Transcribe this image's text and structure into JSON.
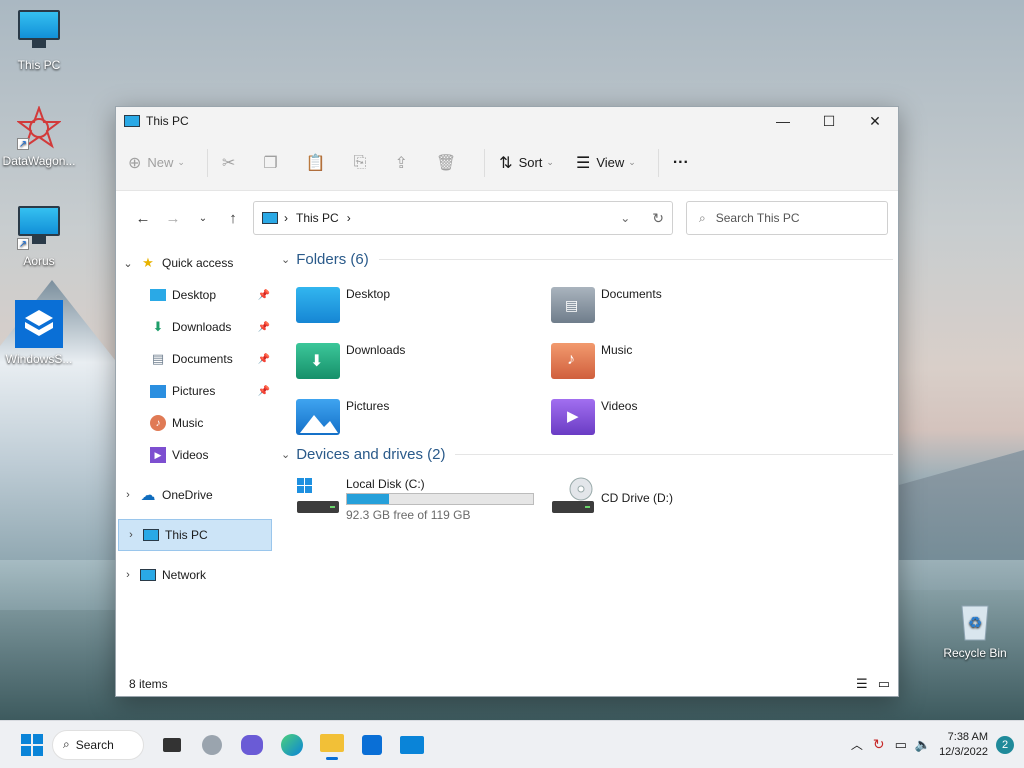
{
  "desktop": {
    "icons": [
      {
        "label": "This PC"
      },
      {
        "label": "DataWagon..."
      },
      {
        "label": "Aorus"
      },
      {
        "label": "WindowsS..."
      },
      {
        "label": "Recycle Bin"
      }
    ]
  },
  "window": {
    "title": "This PC",
    "controls": {
      "minimize": "—",
      "maximize": "☐",
      "close": "✕"
    },
    "commands": {
      "new_label": "New",
      "sort_label": "Sort",
      "view_label": "View",
      "more_label": "···"
    },
    "address": {
      "path": "This PC"
    },
    "search": {
      "placeholder": "Search This PC"
    },
    "sidebar": {
      "quick_access": "Quick access",
      "items": [
        {
          "label": "Desktop",
          "pinned": true
        },
        {
          "label": "Downloads",
          "pinned": true
        },
        {
          "label": "Documents",
          "pinned": true
        },
        {
          "label": "Pictures",
          "pinned": true
        },
        {
          "label": "Music",
          "pinned": false
        },
        {
          "label": "Videos",
          "pinned": false
        }
      ],
      "onedrive": "OneDrive",
      "this_pc": "This PC",
      "network": "Network"
    },
    "content": {
      "folders_header": "Folders (6)",
      "folders": [
        {
          "label": "Desktop"
        },
        {
          "label": "Documents"
        },
        {
          "label": "Downloads"
        },
        {
          "label": "Music"
        },
        {
          "label": "Pictures"
        },
        {
          "label": "Videos"
        }
      ],
      "drives_header": "Devices and drives (2)",
      "drives": [
        {
          "label": "Local Disk (C:)",
          "free": "92.3 GB free of 119 GB",
          "used_fraction": 0.224
        },
        {
          "label": "CD Drive (D:)"
        }
      ]
    },
    "status": {
      "items": "8 items"
    }
  },
  "taskbar": {
    "search_label": "Search",
    "time": "7:38 AM",
    "date": "12/3/2022",
    "notifications": "2"
  },
  "colors": {
    "accent": "#0067c0",
    "selection": "#cce4f7",
    "drive_fill": "#26a0da"
  }
}
